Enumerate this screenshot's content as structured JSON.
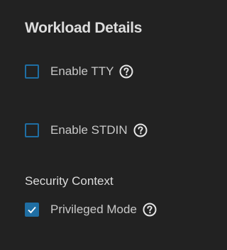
{
  "section": {
    "title": "Workload Details"
  },
  "options": [
    {
      "label": "Enable TTY",
      "checked": false,
      "help_icon": "help-circle-icon"
    },
    {
      "label": "Enable STDIN",
      "checked": false,
      "help_icon": "help-circle-icon"
    }
  ],
  "security_context": {
    "title": "Security Context",
    "privileged": {
      "label": "Privileged Mode",
      "checked": true,
      "help_icon": "help-circle-icon"
    }
  },
  "colors": {
    "background": "#222222",
    "accent": "#1f6ea3",
    "text": "#c9c9c9"
  }
}
